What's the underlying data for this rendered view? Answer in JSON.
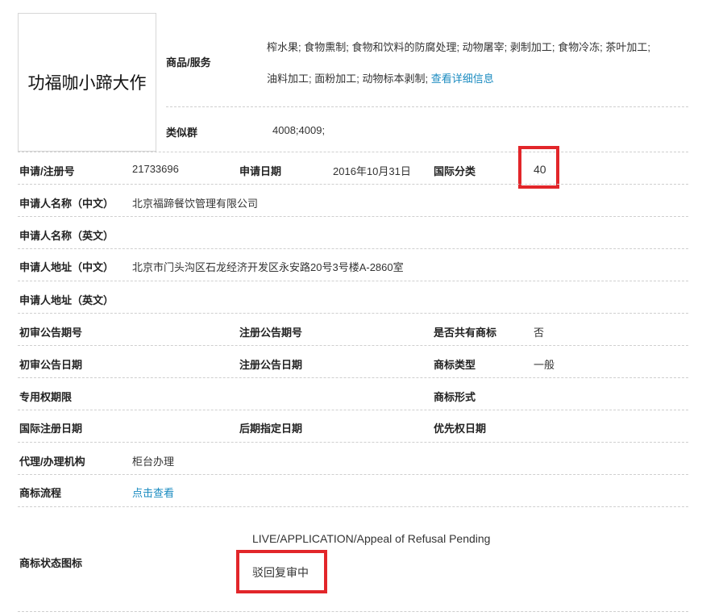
{
  "logo": {
    "text": "功福咖小蹄大作"
  },
  "goods": {
    "label": "商品/服务",
    "line1": "榨水果; 食物熏制; 食物和饮料的防腐处理; 动物屠宰; 剥制加工; 食物冷冻; 茶叶加工;",
    "line2": "油料加工; 面粉加工; 动物标本剥制;",
    "detail_link": "查看详细信息"
  },
  "similar_group": {
    "label": "类似群",
    "value": "4008;4009;"
  },
  "reg_number": {
    "label": "申请/注册号",
    "value": "21733696"
  },
  "app_date": {
    "label": "申请日期",
    "value": "2016年10月31日"
  },
  "intl_class": {
    "label": "国际分类",
    "value": "40"
  },
  "applicant_cn": {
    "label": "申请人名称（中文）",
    "value": "北京福蹄餐饮管理有限公司"
  },
  "applicant_en": {
    "label": "申请人名称（英文）",
    "value": ""
  },
  "address_cn": {
    "label": "申请人地址（中文）",
    "value": "北京市门头沟区石龙经济开发区永安路20号3号楼A-2860室"
  },
  "address_en": {
    "label": "申请人地址（英文）",
    "value": ""
  },
  "prelim_issue": {
    "label": "初审公告期号",
    "value": ""
  },
  "reg_issue": {
    "label": "注册公告期号",
    "value": ""
  },
  "shared": {
    "label": "是否共有商标",
    "value": "否"
  },
  "prelim_date": {
    "label": "初审公告日期",
    "value": ""
  },
  "reg_date": {
    "label": "注册公告日期",
    "value": ""
  },
  "mark_type": {
    "label": "商标类型",
    "value": "一般"
  },
  "exclusive_period": {
    "label": "专用权期限",
    "value": ""
  },
  "mark_form": {
    "label": "商标形式",
    "value": ""
  },
  "intl_reg_date": {
    "label": "国际注册日期",
    "value": ""
  },
  "later_date": {
    "label": "后期指定日期",
    "value": ""
  },
  "priority_date": {
    "label": "优先权日期",
    "value": ""
  },
  "agent": {
    "label": "代理/办理机构",
    "value": "柜台办理"
  },
  "process": {
    "label": "商标流程",
    "link": "点击查看"
  },
  "status": {
    "label": "商标状态图标",
    "english": "LIVE/APPLICATION/Appeal of Refusal Pending",
    "chinese": "驳回复审中"
  },
  "colors": {
    "highlight": "#e2262a",
    "link": "#1a8bc0"
  }
}
